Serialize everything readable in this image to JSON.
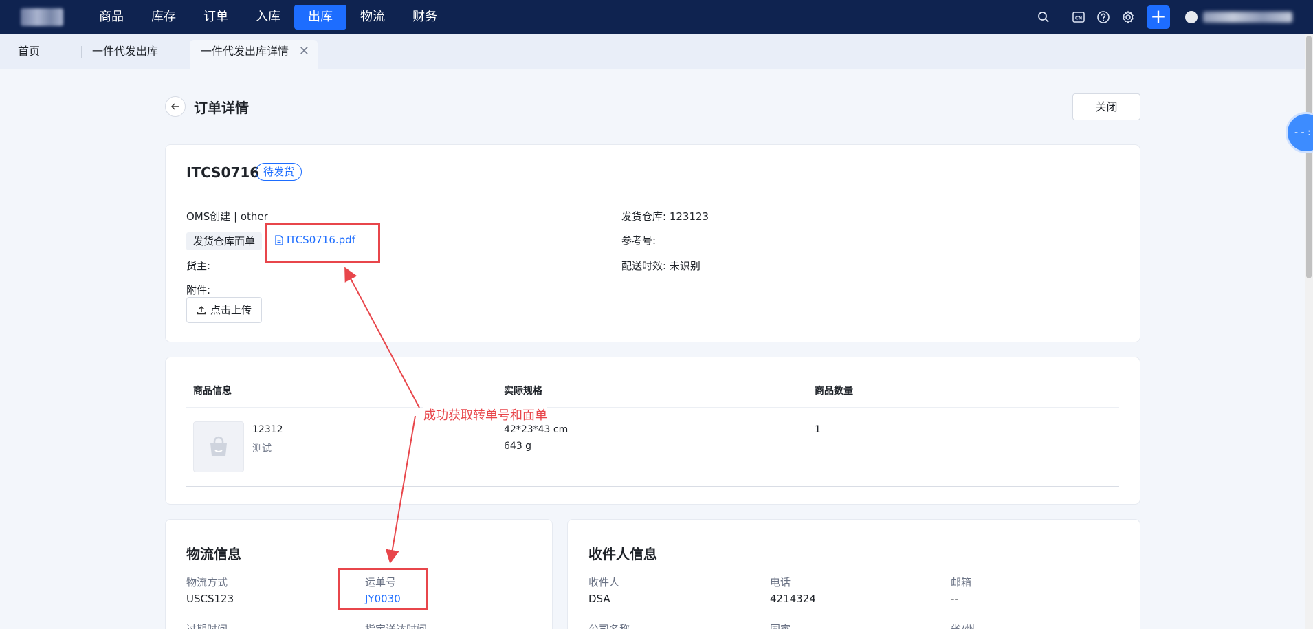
{
  "nav": {
    "items": [
      {
        "label": "商品"
      },
      {
        "label": "库存"
      },
      {
        "label": "订单"
      },
      {
        "label": "入库"
      },
      {
        "label": "出库",
        "active": true
      },
      {
        "label": "物流"
      },
      {
        "label": "财务"
      }
    ],
    "icons": [
      "search-icon",
      "language-cn-icon",
      "help-icon",
      "gear-icon",
      "plus-icon"
    ],
    "lang_badge": "CN"
  },
  "tabs": {
    "home": "首页",
    "outbound": "一件代发出库",
    "detail": "一件代发出库详情",
    "close_glyph": "✕"
  },
  "header": {
    "title": "订单详情",
    "close_label": "关闭"
  },
  "order": {
    "number": "ITCS0716",
    "status": "待发货",
    "created_by": "OMS创建 | other",
    "label_chip": "发货仓库面单",
    "pdf_file": "ITCS0716.pdf",
    "owner_label": "货主:",
    "attachment_label": "附件:",
    "upload_label": "点击上传",
    "warehouse": "发货仓库:  123123",
    "reference": "参考号:",
    "delivery": "配送时效:  未识别"
  },
  "items": {
    "headers": [
      "商品信息",
      "实际规格",
      "商品数量"
    ],
    "rows": [
      {
        "sku": "12312",
        "name": "测试",
        "dims": "42*23*43 cm",
        "weight": "643 g",
        "qty": "1"
      }
    ]
  },
  "logistics": {
    "title": "物流信息",
    "method_label": "物流方式",
    "method_value": "USCS123",
    "tracking_label": "运单号",
    "tracking_value": "JY0030",
    "expire_label": "过期时间",
    "assigned_label": "指定送达时间"
  },
  "recipient": {
    "title": "收件人信息",
    "name_label": "收件人",
    "name_value": "DSA",
    "phone_label": "电话",
    "phone_value": "4214324",
    "email_label": "邮箱",
    "email_value": "--",
    "company_label": "公司名称",
    "country_label": "国家",
    "state_label": "省/州"
  },
  "annotation": {
    "text": "成功获取转单号和面单",
    "color": "#e8464b"
  },
  "float_ball": "- - : -",
  "colors": {
    "nav_bg": "#0f2350",
    "accent": "#1d6dff",
    "annotation": "#e8464b"
  }
}
